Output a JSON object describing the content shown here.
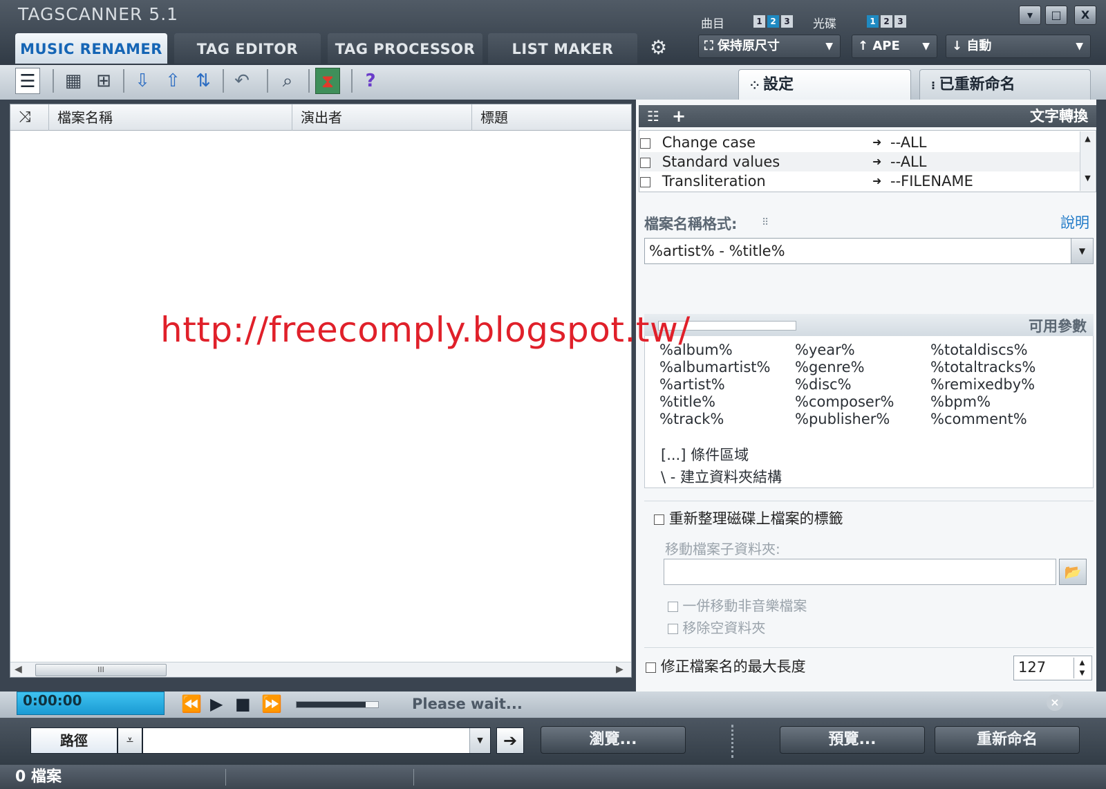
{
  "window": {
    "title": "TAGSCANNER 5.1",
    "min": "▾",
    "max": "□",
    "close": "X"
  },
  "tabs": [
    "MUSIC RENAMER",
    "TAG EDITOR",
    "TAG PROCESSOR",
    "LIST MAKER"
  ],
  "cover": {
    "track_label": "曲目",
    "disc_label": "光碟",
    "track_nums": [
      "1",
      "2",
      "3"
    ],
    "disc_nums": [
      "1",
      "2",
      "3"
    ],
    "size_value": "保持原尺寸",
    "format_value": "APE",
    "mode_value": "自動"
  },
  "right_tabs": {
    "settings": "設定",
    "renamed": "已重新命名"
  },
  "file_list": {
    "columns": [
      "檔案名稱",
      "演出者",
      "標題"
    ],
    "scroll_mark": "III"
  },
  "conversion": {
    "title": "文字轉換",
    "rows": [
      {
        "name": "Change case",
        "target": "--ALL"
      },
      {
        "name": "Standard values",
        "target": "--ALL"
      },
      {
        "name": "Transliteration",
        "target": "--FILENAME"
      }
    ]
  },
  "format": {
    "label": "檔案名稱格式:",
    "help": "說明",
    "value": "%artist% - %title%"
  },
  "watermark": "http://freecomply.blogspot.tw/",
  "params": {
    "title": "可用參數",
    "col1": [
      "%album%",
      "%albumartist%",
      "%artist%",
      "%title%",
      "%track%"
    ],
    "col2": [
      "%year%",
      "%genre%",
      "%disc%",
      "%composer%",
      "%publisher%"
    ],
    "col3": [
      "%totaldiscs%",
      "%totaltracks%",
      "%remixedby%",
      "%bpm%",
      "%comment%"
    ],
    "cond": "[...] 條件區域",
    "folder": "\\ - 建立資料夾結構"
  },
  "organize": {
    "reorganize_label": "重新整理磁碟上檔案的標籤",
    "move_label": "移動檔案子資料夾:",
    "move_value": "",
    "move_nonmusic": "一併移動非音樂檔案",
    "remove_empty": "移除空資料夾",
    "maxlen_label": "修正檔案名的最大長度",
    "maxlen_value": "127"
  },
  "player": {
    "time": "0:00:00",
    "status": "Please wait...",
    "progress": 0.85
  },
  "bottom": {
    "path_label": "路徑",
    "path_value": "",
    "browse": "瀏覽...",
    "preview": "預覽...",
    "rename": "重新命名"
  },
  "status": {
    "files": "0 檔案"
  }
}
